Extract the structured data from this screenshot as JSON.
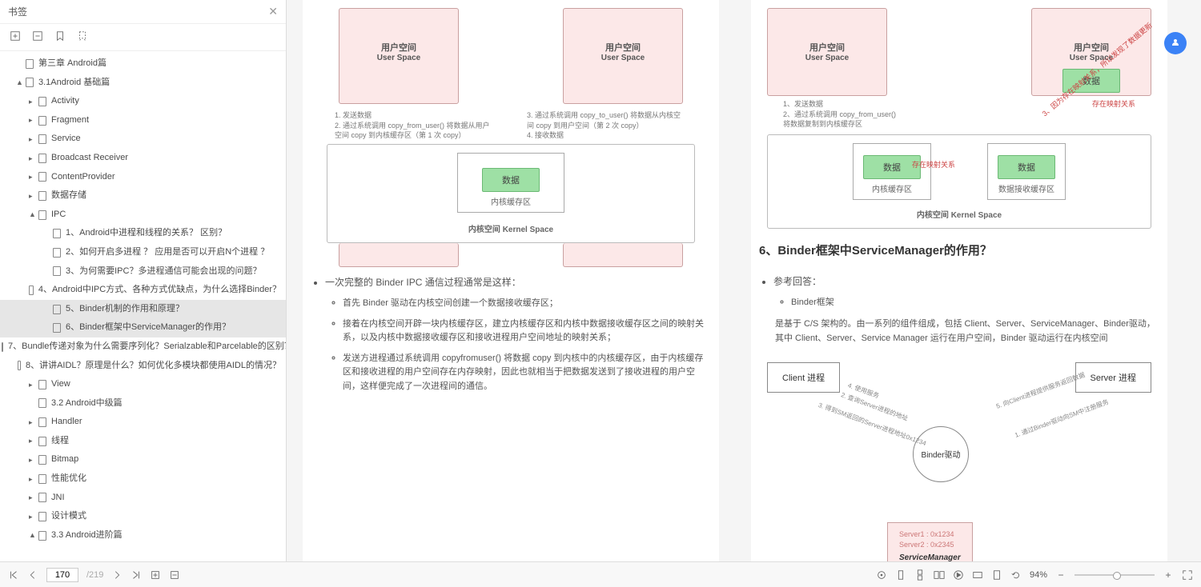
{
  "sidebar": {
    "title": "书签",
    "tree": [
      {
        "ind": 20,
        "tw": "",
        "label": "第三章 Android篇"
      },
      {
        "ind": 20,
        "tw": "▲",
        "label": "3.1Android 基础篇"
      },
      {
        "ind": 36,
        "tw": "▸",
        "label": "Activity"
      },
      {
        "ind": 36,
        "tw": "▸",
        "label": "Fragment"
      },
      {
        "ind": 36,
        "tw": "▸",
        "label": "Service"
      },
      {
        "ind": 36,
        "tw": "▸",
        "label": "Broadcast Receiver"
      },
      {
        "ind": 36,
        "tw": "▸",
        "label": "ContentProvider"
      },
      {
        "ind": 36,
        "tw": "▸",
        "label": "数据存储"
      },
      {
        "ind": 36,
        "tw": "▲",
        "label": "IPC"
      },
      {
        "ind": 54,
        "tw": "",
        "label": "1、Android中进程和线程的关系？ 区别？"
      },
      {
        "ind": 54,
        "tw": "",
        "label": "2、如何开启多进程 ？ 应用是否可以开启N个进程 ？"
      },
      {
        "ind": 54,
        "tw": "",
        "label": "3、为何需要IPC？多进程通信可能会出现的问题？"
      },
      {
        "ind": 54,
        "tw": "",
        "label": "4、Android中IPC方式、各种方式优缺点，为什么选择Binder？"
      },
      {
        "ind": 54,
        "tw": "",
        "label": "5、Binder机制的作用和原理？",
        "sel": true
      },
      {
        "ind": 54,
        "tw": "",
        "label": "6、Binder框架中ServiceManager的作用？",
        "sel": true
      },
      {
        "ind": 54,
        "tw": "",
        "label": "7、Bundle传递对象为什么需要序列化？Serialzable和Parcelable的区别？"
      },
      {
        "ind": 54,
        "tw": "",
        "label": "8、讲讲AIDL？原理是什么？如何优化多模块都使用AIDL的情况？"
      },
      {
        "ind": 36,
        "tw": "▸",
        "label": "View"
      },
      {
        "ind": 36,
        "tw": "",
        "label": "3.2 Android中级篇"
      },
      {
        "ind": 36,
        "tw": "▸",
        "label": "Handler"
      },
      {
        "ind": 36,
        "tw": "▸",
        "label": "线程"
      },
      {
        "ind": 36,
        "tw": "▸",
        "label": "Bitmap"
      },
      {
        "ind": 36,
        "tw": "▸",
        "label": "性能优化"
      },
      {
        "ind": 36,
        "tw": "▸",
        "label": "JNI"
      },
      {
        "ind": 36,
        "tw": "▸",
        "label": "设计模式"
      },
      {
        "ind": 36,
        "tw": "▲",
        "label": "3.3 Android进阶篇"
      }
    ]
  },
  "footer": {
    "page_current": "170",
    "page_total": "/219",
    "zoom": "94%"
  },
  "doc": {
    "l": {
      "us_title": "用户空间",
      "us_sub": "User Space",
      "data_lbl": "数据",
      "note_l": "1. 发送数据\n2. 通过系统调用 copy_from_user() 将数据从用户空间 copy 到内核缓存区（第 1 次 copy）",
      "note_r": "3. 通过系统调用 copy_to_user() 将数据从内核空间 copy 到用户空间（第 2 次 copy）\n4. 接收数据",
      "kbuf": "内核缓存区",
      "klabel": "内核空间 Kernel Space",
      "ipc_intro": "一次完整的 Binder IPC 通信过程通常是这样：",
      "b1": "首先 Binder 驱动在内核空间创建一个数据接收缓存区；",
      "b2": "接着在内核空间开辟一块内核缓存区，建立内核缓存区和内核中数据接收缓存区之间的映射关系，以及内核中数据接收缓存区和接收进程用户空间地址的映射关系；",
      "b3": "发送方进程通过系统调用 copyfromuser() 将数据 copy 到内核中的内核缓存区，由于内核缓存区和接收进程的用户空间存在内存映射，因此也就相当于把数据发送到了接收进程的用户空间，这样便完成了一次进程间的通信。"
    },
    "r": {
      "us_title": "用户空间",
      "us_sub": "User Space",
      "data_lbl": "数据",
      "note_l": "1、发送数据\n2、通过系统调用 copy_from_user()\n将数据复制到内核缓存区",
      "annot_map": "存在映射关系",
      "annot_map2": "3、因为存在映射关系，所以发现了数据更新",
      "kbuf1": "内核缓存区",
      "kbuf2": "数据接收缓存区",
      "klabel": "内核空间 Kernel Space",
      "h6": "6、Binder框架中ServiceManager的作用？",
      "ref": "参考回答：",
      "bf_title": "Binder框架",
      "desc": "是基于 C/S 架构的。由一系列的组件组成，包括 Client、Server、ServiceManager、Binder驱动，其中 Client、Server、Service Manager 运行在用户空间，Binder 驱动运行在内核空间",
      "bf_client": "Client 进程",
      "bf_server": "Server 进程",
      "bf_driver": "Binder驱动",
      "bf_sm": "ServiceManager",
      "bf_sm_l1": "Server1 : 0x1234",
      "bf_sm_l2": "Server2 : 0x2345",
      "ar1": "4. 使用服务",
      "ar2": "2. 查询Server进程的地址",
      "ar3": "3. 得到SM返回的Server进程地址0x1234",
      "ar4": "5. 向Client进程提供服务返回数据",
      "ar5": "1. 通过Binder驱动向SM中注册服务"
    }
  }
}
